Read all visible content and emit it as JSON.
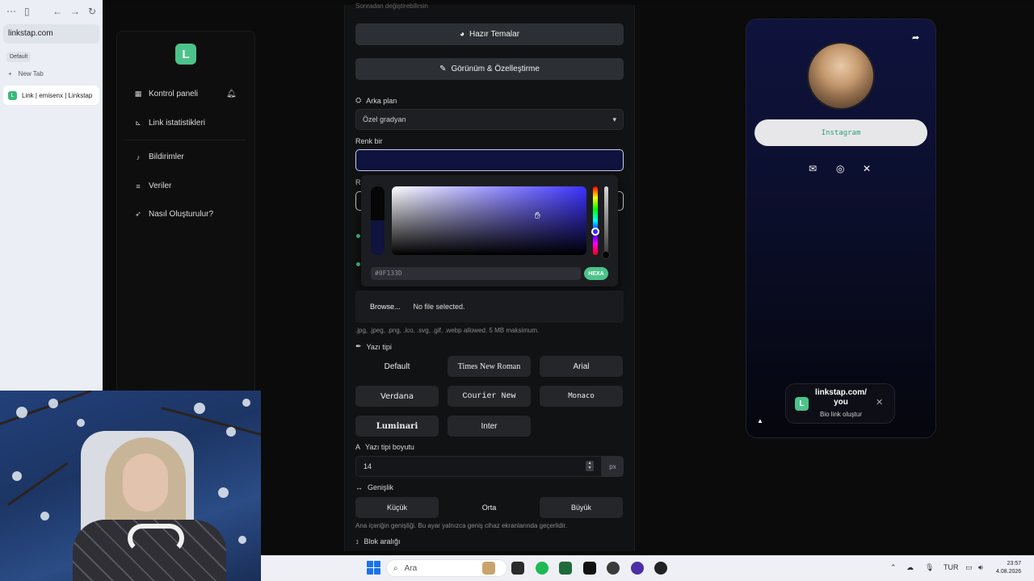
{
  "browser": {
    "url": "linkstap.com",
    "profile": "Default",
    "new_tab_label": "New Tab",
    "active_tab_label": "Link | emisenx | Linkstap"
  },
  "nav": {
    "items": [
      {
        "label": "Kontrol paneli",
        "icon": "grid-icon"
      },
      {
        "label": "Link istatistikleri",
        "icon": "chart-icon"
      },
      {
        "label": "Bildirimler",
        "icon": "bell-icon"
      },
      {
        "label": "Veriler",
        "icon": "database-icon"
      },
      {
        "label": "Nasıl Oluşturulur?",
        "icon": "rocket-icon"
      }
    ]
  },
  "editor": {
    "top_note": "Sonradan değiştirebilirsin",
    "themes_button": "Hazır Temalar",
    "appearance_button": "Görünüm & Özelleştirme",
    "background_label": "Arka plan",
    "background_value": "Özel gradyan",
    "color_one_label": "Renk bir",
    "color_one_value": "#0F133D",
    "color_two_label_fragment": "R",
    "picker": {
      "hex_value": "#0F133D",
      "mode_label": "HEXA"
    },
    "file": {
      "browse_label": "Browse...",
      "status": "No file selected.",
      "hint": ".jpg, .jpeg, .png, .ico, .svg, .gif, .webp allowed. 5 MB maksimum."
    },
    "font_label": "Yazı tipi",
    "fonts": [
      "Default",
      "Times New Roman",
      "Arial",
      "Verdana",
      "Courier New",
      "Monaco",
      "Luminari",
      "Inter"
    ],
    "font_size_label": "Yazı tipi boyutu",
    "font_size_value": "14",
    "font_size_unit": "px",
    "width_label": "Genişlik",
    "width_options": [
      "Küçük",
      "Orta",
      "Büyük"
    ],
    "width_hint": "Ana içeriğin genişliği. Bu ayar yalnızca geniş cihaz ekranlarında geçerlidir.",
    "block_spacing_label": "Blok aralığı"
  },
  "preview": {
    "link_button": "Instagram",
    "promo_title": "linkstap.com/\nyou",
    "promo_subtitle": "Bio link oluştur",
    "background_color": "#0F133D"
  },
  "taskbar": {
    "search_placeholder": "Ara",
    "language": "TUR",
    "time": "23:57",
    "date": "4.08.2026"
  }
}
